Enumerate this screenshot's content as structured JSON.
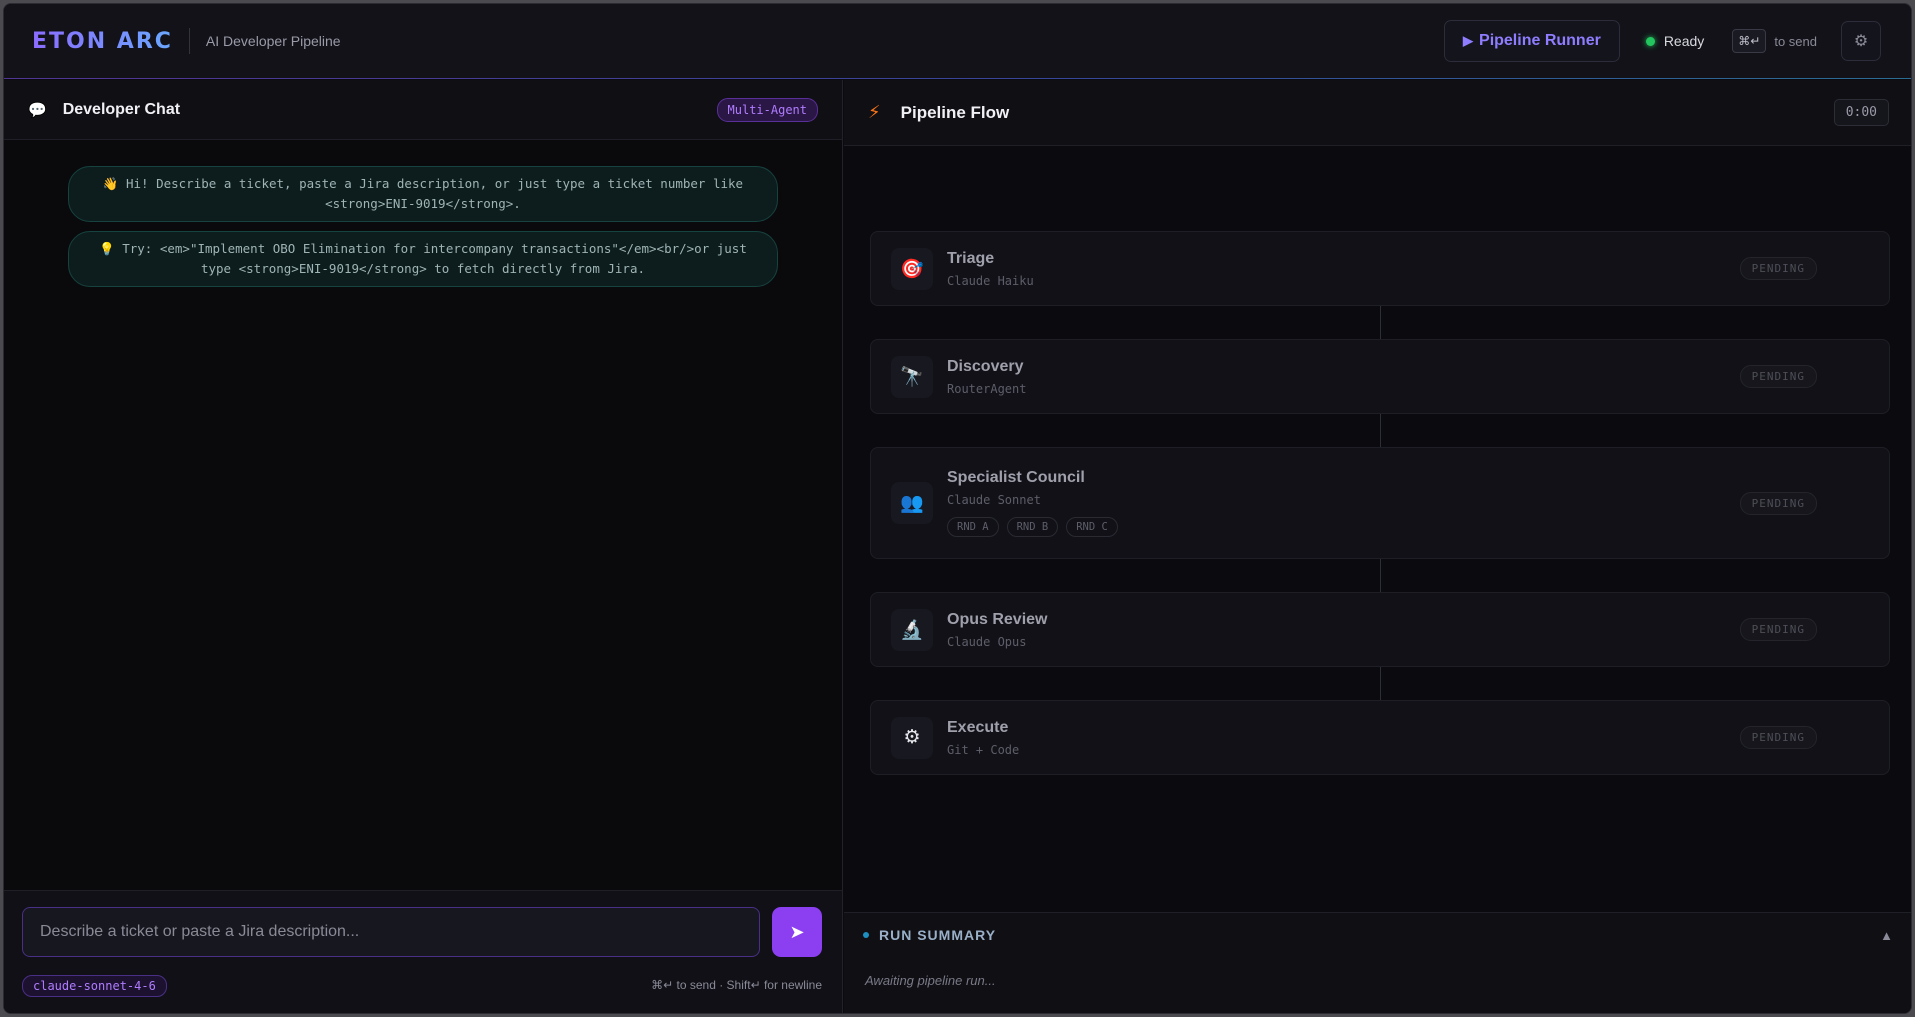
{
  "header": {
    "brand": "ETON ARC",
    "subtitle": "AI Developer Pipeline",
    "runner_label": "Pipeline Runner",
    "status_text": "Ready",
    "shortcut_key": "⌘↵",
    "shortcut_label": "to send",
    "status_color": "#22c55e"
  },
  "chat": {
    "title": "Developer Chat",
    "badge": "Multi-Agent",
    "messages": [
      "👋 Hi! Describe a ticket, paste a Jira description, or just type a ticket number like <strong>ENI-9019</strong>.",
      "💡 Try: <em>\"Implement OBO Elimination for intercompany transactions\"</em><br/>or just type <strong>ENI-9019</strong> to fetch directly from Jira."
    ],
    "input_placeholder": "Describe a ticket or paste a Jira description...",
    "model": "claude-sonnet-4-6",
    "hint": "⌘↵ to send · Shift↵ for newline"
  },
  "pipeline": {
    "title": "Pipeline Flow",
    "timer": "0:00",
    "stages": [
      {
        "name": "Triage",
        "model": "Claude Haiku",
        "status": "PENDING",
        "icon": "target-icon"
      },
      {
        "name": "Discovery",
        "model": "RouterAgent",
        "status": "PENDING",
        "icon": "telescope-icon"
      },
      {
        "name": "Specialist Council",
        "model": "Claude Sonnet",
        "status": "PENDING",
        "icon": "people-icon",
        "rounds": [
          "RND A",
          "RND B",
          "RND C"
        ]
      },
      {
        "name": "Opus Review",
        "model": "Claude Opus",
        "status": "PENDING",
        "icon": "microscope-icon"
      },
      {
        "name": "Execute",
        "model": "Git + Code",
        "status": "PENDING",
        "icon": "gear-icon"
      }
    ]
  },
  "summary": {
    "title": "RUN SUMMARY",
    "body": "Awaiting pipeline run..."
  }
}
